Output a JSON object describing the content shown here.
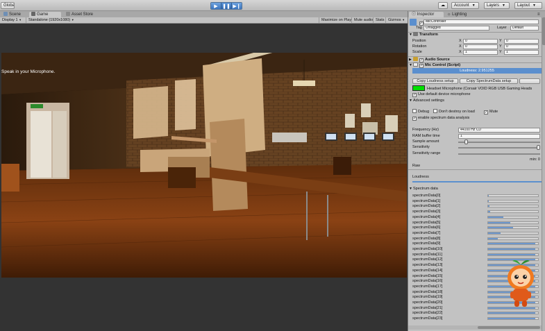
{
  "toolbar": {
    "global_label": "Global",
    "cloud_icon": "cloud-icon",
    "account_label": "Account",
    "layers_label": "Layers",
    "layout_label": "Layout"
  },
  "game_panel": {
    "tabs": [
      {
        "label": "Scene",
        "icon": "scene-icon"
      },
      {
        "label": "Game",
        "icon": "game-icon"
      },
      {
        "label": "Asset Store",
        "icon": "asset-store-icon"
      }
    ],
    "display": "Display 1",
    "resolution": "Standalone (1920x1080)",
    "options": [
      "Maximize on Play",
      "Mute audio",
      "Stats",
      "Gizmos"
    ],
    "hint_text": "Speak in your Microphone."
  },
  "inspector": {
    "tabs": [
      {
        "label": "Inspector",
        "icon": "inspector-icon"
      },
      {
        "label": "Lighting",
        "icon": "lighting-icon"
      }
    ],
    "object_name": "MicController",
    "tag_label": "Tag",
    "tag_value": "Untagged",
    "layer_label": "Layer",
    "layer_value": "Default",
    "transform": {
      "title": "Transform",
      "rows": [
        {
          "label": "Position",
          "x": "0",
          "y": "0"
        },
        {
          "label": "Rotation",
          "x": "0",
          "y": "0"
        },
        {
          "label": "Scale",
          "x": "1",
          "y": "1"
        }
      ],
      "axis_x": "X",
      "axis_y": "Y"
    },
    "audio_source_title": "Audio Source",
    "mic_control_title": "Mic Control (Script)",
    "loudness_readout": "Loudness: 2.951255",
    "copy_loudness_button": "Copy Loudness setup",
    "copy_spectrum_button": "Copy SpectrumData setup",
    "device_name": "Headset Microphone (Corsair VOID RGB USB Gaming Heads",
    "use_default_label": "Use default device microphone",
    "advanced_label": "Advanced settings",
    "debug_label": "Debug",
    "dont_destroy_label": "Don't destroy on load",
    "mute_label": "Mute",
    "enable_spectrum_label": "enable spectrum data analysis",
    "frequency_label": "Frequency (Hz)",
    "frequency_value": "44100 Hz CD",
    "ram_label": "RAM buffer time",
    "ram_value": "1",
    "sample_label": "Sample amount",
    "sample_level": 0.08,
    "sensitivity_label": "Sensitivity",
    "sensitivity_level": 1.0,
    "sensitivity_range_label": "Sensitivity range",
    "min_label": "min: 0",
    "raw_label": "Raw",
    "loudness_label": "Loudness",
    "spectrum_title": "Spectrum data",
    "spectrum": [
      {
        "label": "spectrumData[0]",
        "level": 0.02
      },
      {
        "label": "spectrumData[1]",
        "level": 0.02
      },
      {
        "label": "spectrumData[2]",
        "level": 0.03
      },
      {
        "label": "spectrumData[3]",
        "level": 0.04
      },
      {
        "label": "spectrumData[4]",
        "level": 0.3
      },
      {
        "label": "spectrumData[5]",
        "level": 0.45
      },
      {
        "label": "spectrumData[6]",
        "level": 0.5
      },
      {
        "label": "spectrumData[7]",
        "level": 0.25
      },
      {
        "label": "spectrumData[8]",
        "level": 0.2
      },
      {
        "label": "spectrumData[9]",
        "level": 0.95
      },
      {
        "label": "spectrumData[10]",
        "level": 0.95
      },
      {
        "label": "spectrumData[11]",
        "level": 0.95
      },
      {
        "label": "spectrumData[12]",
        "level": 0.95
      },
      {
        "label": "spectrumData[13]",
        "level": 0.95
      },
      {
        "label": "spectrumData[14]",
        "level": 0.95
      },
      {
        "label": "spectrumData[15]",
        "level": 0.95
      },
      {
        "label": "spectrumData[16]",
        "level": 0.95
      },
      {
        "label": "spectrumData[17]",
        "level": 0.95
      },
      {
        "label": "spectrumData[18]",
        "level": 0.95
      },
      {
        "label": "spectrumData[19]",
        "level": 0.95
      },
      {
        "label": "spectrumData[20]",
        "level": 0.95
      },
      {
        "label": "spectrumData[21]",
        "level": 0.95
      },
      {
        "label": "spectrumData[22]",
        "level": 0.95
      },
      {
        "label": "spectrumData[23]",
        "level": 0.95
      }
    ]
  }
}
